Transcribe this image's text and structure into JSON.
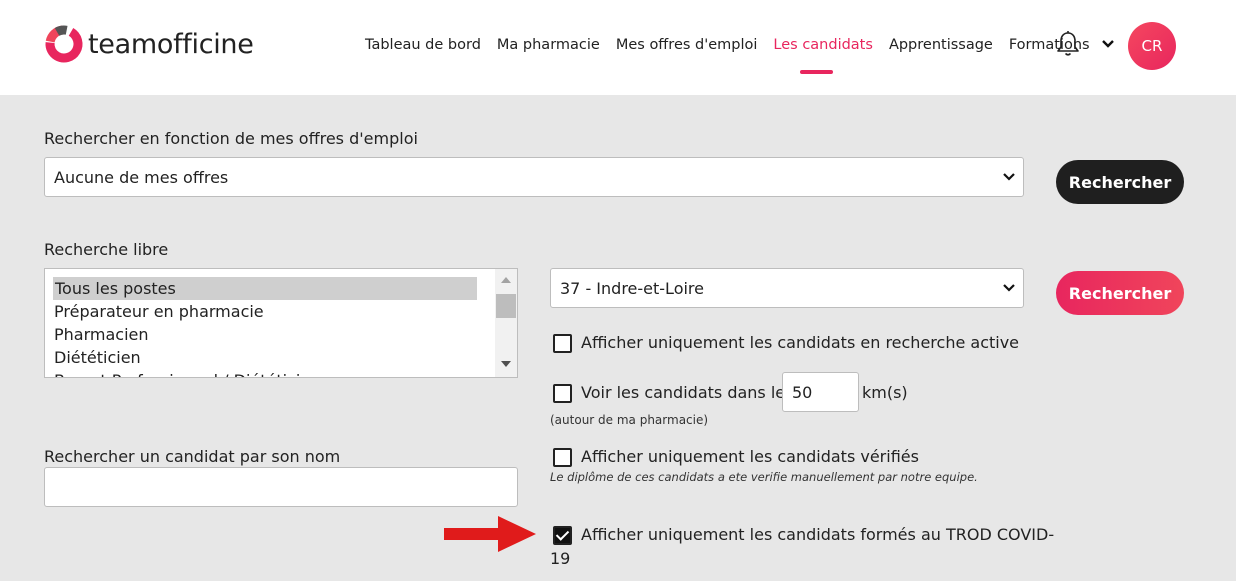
{
  "brand": {
    "name_light": "team",
    "name_bold": "officine"
  },
  "nav": {
    "items": [
      "Tableau de bord",
      "Ma pharmacie",
      "Mes offres d'emploi",
      "Les candidats",
      "Apprentissage",
      "Formations"
    ],
    "active": "Les candidats"
  },
  "user": {
    "initials": "CR"
  },
  "offers_search": {
    "label": "Rechercher en fonction de mes offres d'emploi",
    "selected": "Aucune de mes offres",
    "button": "Rechercher"
  },
  "free_search": {
    "label": "Recherche libre",
    "positions": [
      "Tous les postes",
      "Préparateur en pharmacie",
      "Pharmacien",
      "Diététicien",
      "Brevet Professionnel / Diététicien"
    ],
    "selected_position": "Tous les postes",
    "department": "37 - Indre-et-Loire",
    "button": "Rechercher"
  },
  "filters": {
    "active_search": {
      "label": "Afficher uniquement les candidats en recherche active",
      "checked": false
    },
    "radius": {
      "label_before": "Voir les candidats dans les",
      "value": "50",
      "unit": "km(s)",
      "note": "(autour de ma pharmacie)",
      "checked": false
    },
    "verified": {
      "label": "Afficher uniquement les candidats vérifiés",
      "note": "Le diplôme de ces candidats a ete verifie manuellement par notre equipe.",
      "checked": false
    },
    "trod": {
      "label_line1": "Afficher uniquement les candidats formés au TROD COVID-",
      "label_line2": "19",
      "checked": true
    }
  },
  "name_search": {
    "label": "Rechercher un candidat par son nom",
    "value": ""
  },
  "colors": {
    "accent": "#e8265e",
    "dark_button": "#1f1f1f",
    "background": "#e7e7e7",
    "arrow": "#e01b1b"
  }
}
